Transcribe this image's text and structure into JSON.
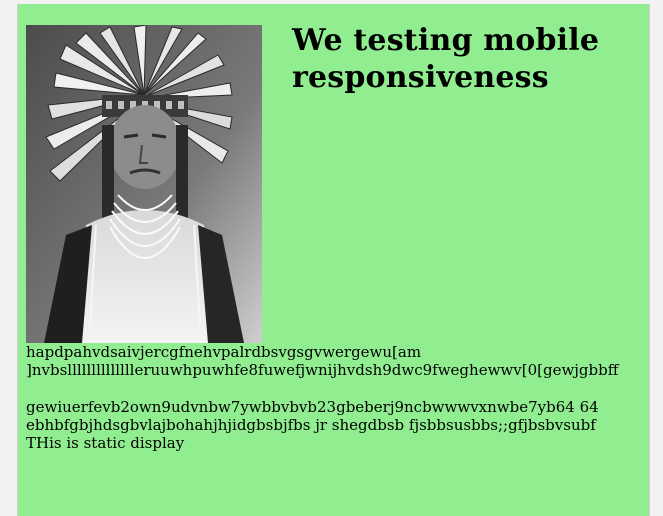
{
  "heading": {
    "line1": "We testing mobile",
    "line2": "responsiveness"
  },
  "image": {
    "subject": "portrait-photo"
  },
  "paragraphs": [
    {
      "line1": "hapdpahvdsaivjercgfnehvpalrdbsvgsgvwergewu[am",
      "line2": "]nvbslllllllllllllleruuwhpuwhfe8fuwefjwnijhvdsh9dwc9fweghewwv[0[gewjgbbff"
    },
    {
      "line1": "gewiuerfevb2own9udvnbw7ywbbvbvb23gbeberj9ncbwwwvxnwbe7yb64 64",
      "line2": "ebhbfgbjhdsgbvlajbohahjhjidgbsbjfbs jr shegdbsb fjsbbsusbbs;;gfjbsbvsubf",
      "line3": "THis is static display"
    }
  ],
  "colors": {
    "panel_background": "#90ee90",
    "page_background": "#f2f2f2"
  }
}
